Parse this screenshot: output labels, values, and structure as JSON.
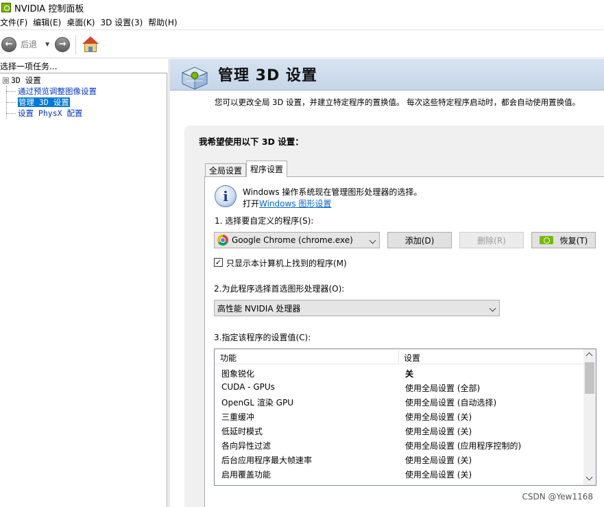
{
  "window": {
    "title": "NVIDIA 控制面板"
  },
  "menu": [
    "文件(F)",
    "编辑(E)",
    "桌面(K)",
    "3D 设置(3)",
    "帮助(H)"
  ],
  "toolbar": {
    "back_label": "后退"
  },
  "left": {
    "header": "选择一项任务...",
    "root": "3D 设置",
    "toggle": "⊟",
    "items": [
      "通过预览调整图像设置",
      "管理 3D 设置",
      "设置 PhysX 配置"
    ]
  },
  "banner": {
    "title": "管理 3D 设置",
    "description": "您可以更改全局 3D 设置，并建立特定程序的置换值。 每次这些特定程序启动时，都会自动使用置换值。"
  },
  "content": {
    "heading": "我希望使用以下 3D 设置：",
    "tabs": [
      "全局设置",
      "程序设置"
    ],
    "info_line1": "Windows 操作系统现在管理图形处理器的选择。",
    "info_prefix": "打开",
    "info_link": "Windows 图形设置",
    "step1_label": "1. 选择要自定义的程序(S):",
    "program_combo": "Google Chrome (chrome.exe)",
    "add_button": "添加(D)",
    "remove_button": "删除(R)",
    "restore_button": "恢复(T)",
    "checkbox_label": "只显示本计算机上找到的程序(M)",
    "step2_label": "2.为此程序选择首选图形处理器(O):",
    "gpu_combo": "高性能 NVIDIA 处理器",
    "step3_label": "3.指定该程序的设置值(C):",
    "table": {
      "headers": [
        "功能",
        "设置"
      ],
      "rows": [
        [
          "图象锐化",
          "关"
        ],
        [
          "CUDA - GPUs",
          "使用全局设置 (全部)"
        ],
        [
          "OpenGL 渲染 GPU",
          "使用全局设置 (自动选择)"
        ],
        [
          "三重缓冲",
          "使用全局设置 (关)"
        ],
        [
          "低延时模式",
          "使用全局设置 (关)"
        ],
        [
          "各向异性过滤",
          "使用全局设置 (应用程序控制的)"
        ],
        [
          "后台应用程序最大帧速率",
          "使用全局设置 (关)"
        ],
        [
          "启用覆盖功能",
          "使用全局设置 (关)"
        ]
      ]
    }
  },
  "watermark": "CSDN @Yew1168",
  "colors": {
    "nvidia_green": "#76b900",
    "selection_blue": "#0078d7",
    "link_blue": "#0066cc"
  }
}
